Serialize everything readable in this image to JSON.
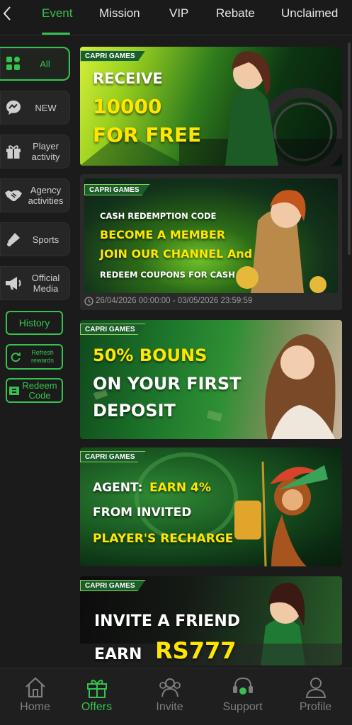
{
  "colors": {
    "accent": "#36c24e",
    "background": "#1b1b1b",
    "tile": "#262626",
    "highlight_yellow": "#ffe600"
  },
  "top_tabs": [
    {
      "label": "Event",
      "active": true
    },
    {
      "label": "Mission"
    },
    {
      "label": "VIP"
    },
    {
      "label": "Rebate"
    },
    {
      "label": "Unclaimed"
    }
  ],
  "back_icon": "chevron-left-icon",
  "sidebar": {
    "items": [
      {
        "label": "All",
        "icon": "grid-icon",
        "active": true
      },
      {
        "label": "NEW",
        "icon": "chat-bubble-icon"
      },
      {
        "label": "Player activity",
        "icon": "gift-icon"
      },
      {
        "label": "Agency activities",
        "icon": "handshake-icon"
      },
      {
        "label": "Sports",
        "icon": "sports-icon"
      },
      {
        "label": "Official Media",
        "icon": "megaphone-icon"
      }
    ],
    "history": "History",
    "refresh": "Refresh rewards",
    "redeem": "Redeem Code"
  },
  "banners": [
    {
      "brand": "CAPRI GAMES",
      "lines": [
        "RECEIVE",
        "10000",
        "FOR FREE"
      ]
    },
    {
      "brand": "CAPRI GAMES",
      "lines": [
        "CASH REDEMPTION CODE",
        "BECOME A MEMBER",
        "JOIN OUR CHANNEL And",
        "REDEEM COUPONS FOR CASH"
      ],
      "date_range": "26/04/2026 00:00:00 - 03/05/2026 23:59:59"
    },
    {
      "brand": "CAPRI GAMES",
      "lines": [
        "50% BOUNS",
        "ON YOUR FIRST",
        "DEPOSIT"
      ]
    },
    {
      "brand": "CAPRI GAMES",
      "lines": [
        "AGENT:",
        "EARN 4%",
        "FROM INVITED",
        "PLAYER'S RECHARGE"
      ]
    },
    {
      "brand": "CAPRI GAMES",
      "lines": [
        "INVITE A FRIEND",
        "EARN",
        "RS777"
      ]
    }
  ],
  "bottom_nav": [
    {
      "label": "Home",
      "icon": "home-icon"
    },
    {
      "label": "Offers",
      "icon": "gift-icon",
      "active": true
    },
    {
      "label": "Invite",
      "icon": "people-icon"
    },
    {
      "label": "Support",
      "icon": "headset-icon"
    },
    {
      "label": "Profile",
      "icon": "person-icon"
    }
  ]
}
